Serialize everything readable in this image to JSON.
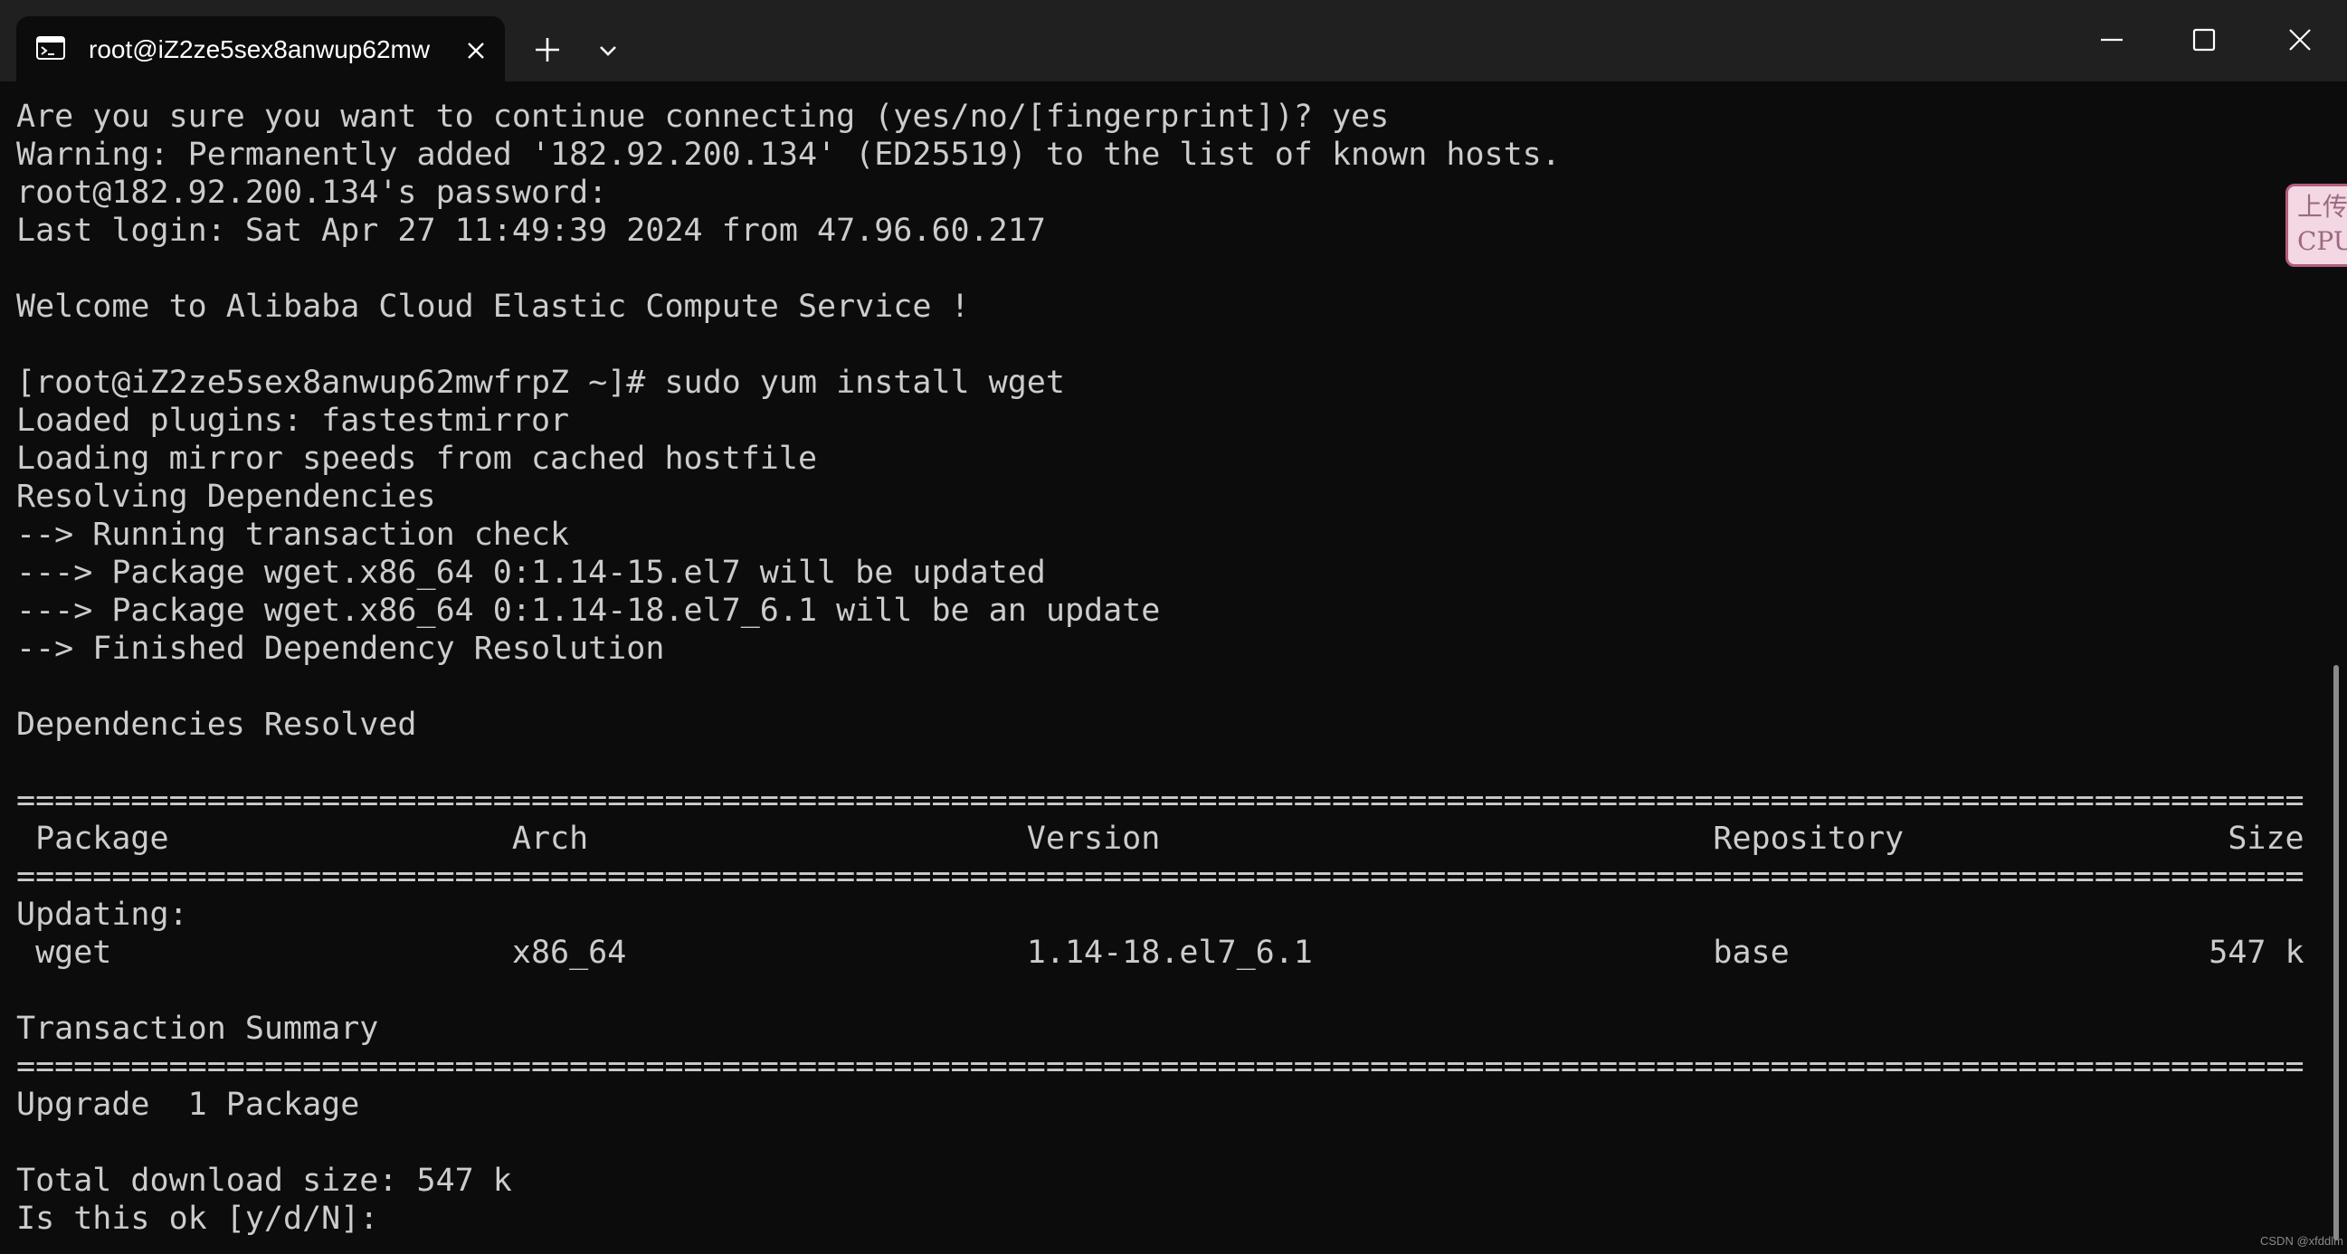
{
  "window": {
    "tab_title": "root@iZ2ze5sex8anwup62mw",
    "icons": {
      "tab": "terminal-icon",
      "tab_close": "close-icon",
      "new_tab": "plus-icon",
      "dropdown": "chevron-down-icon",
      "minimize": "minimize-icon",
      "maximize": "maximize-icon",
      "close": "close-icon"
    }
  },
  "terminal": {
    "lines": [
      "Are you sure you want to continue connecting (yes/no/[fingerprint])? yes",
      "Warning: Permanently added '182.92.200.134' (ED25519) to the list of known hosts.",
      "root@182.92.200.134's password:",
      "Last login: Sat Apr 27 11:49:39 2024 from 47.96.60.217",
      "",
      "Welcome to Alibaba Cloud Elastic Compute Service !",
      "",
      "[root@iZ2ze5sex8anwup62mwfrpZ ~]# sudo yum install wget",
      "Loaded plugins: fastestmirror",
      "Loading mirror speeds from cached hostfile",
      "Resolving Dependencies",
      "--> Running transaction check",
      "---> Package wget.x86_64 0:1.14-15.el7 will be updated",
      "---> Package wget.x86_64 0:1.14-18.el7_6.1 will be an update",
      "--> Finished Dependency Resolution",
      "",
      "Dependencies Resolved",
      "",
      "========================================================================================================================",
      " Package                  Arch                       Version                             Repository                 Size",
      "========================================================================================================================",
      "Updating:",
      " wget                     x86_64                     1.14-18.el7_6.1                     base                      547 k",
      "",
      "Transaction Summary",
      "========================================================================================================================",
      "Upgrade  1 Package",
      "",
      "Total download size: 547 k",
      "Is this ok [y/d/N]:"
    ]
  },
  "side_widget": {
    "line1": "上传",
    "line2": "CPU"
  },
  "watermark": "CSDN @xfddlm",
  "colors": {
    "background": "#0c0c0c",
    "titlebar": "#202020",
    "text": "#cccccc",
    "widget_bg": "#f3d7e3",
    "widget_border": "#b25d7f"
  }
}
